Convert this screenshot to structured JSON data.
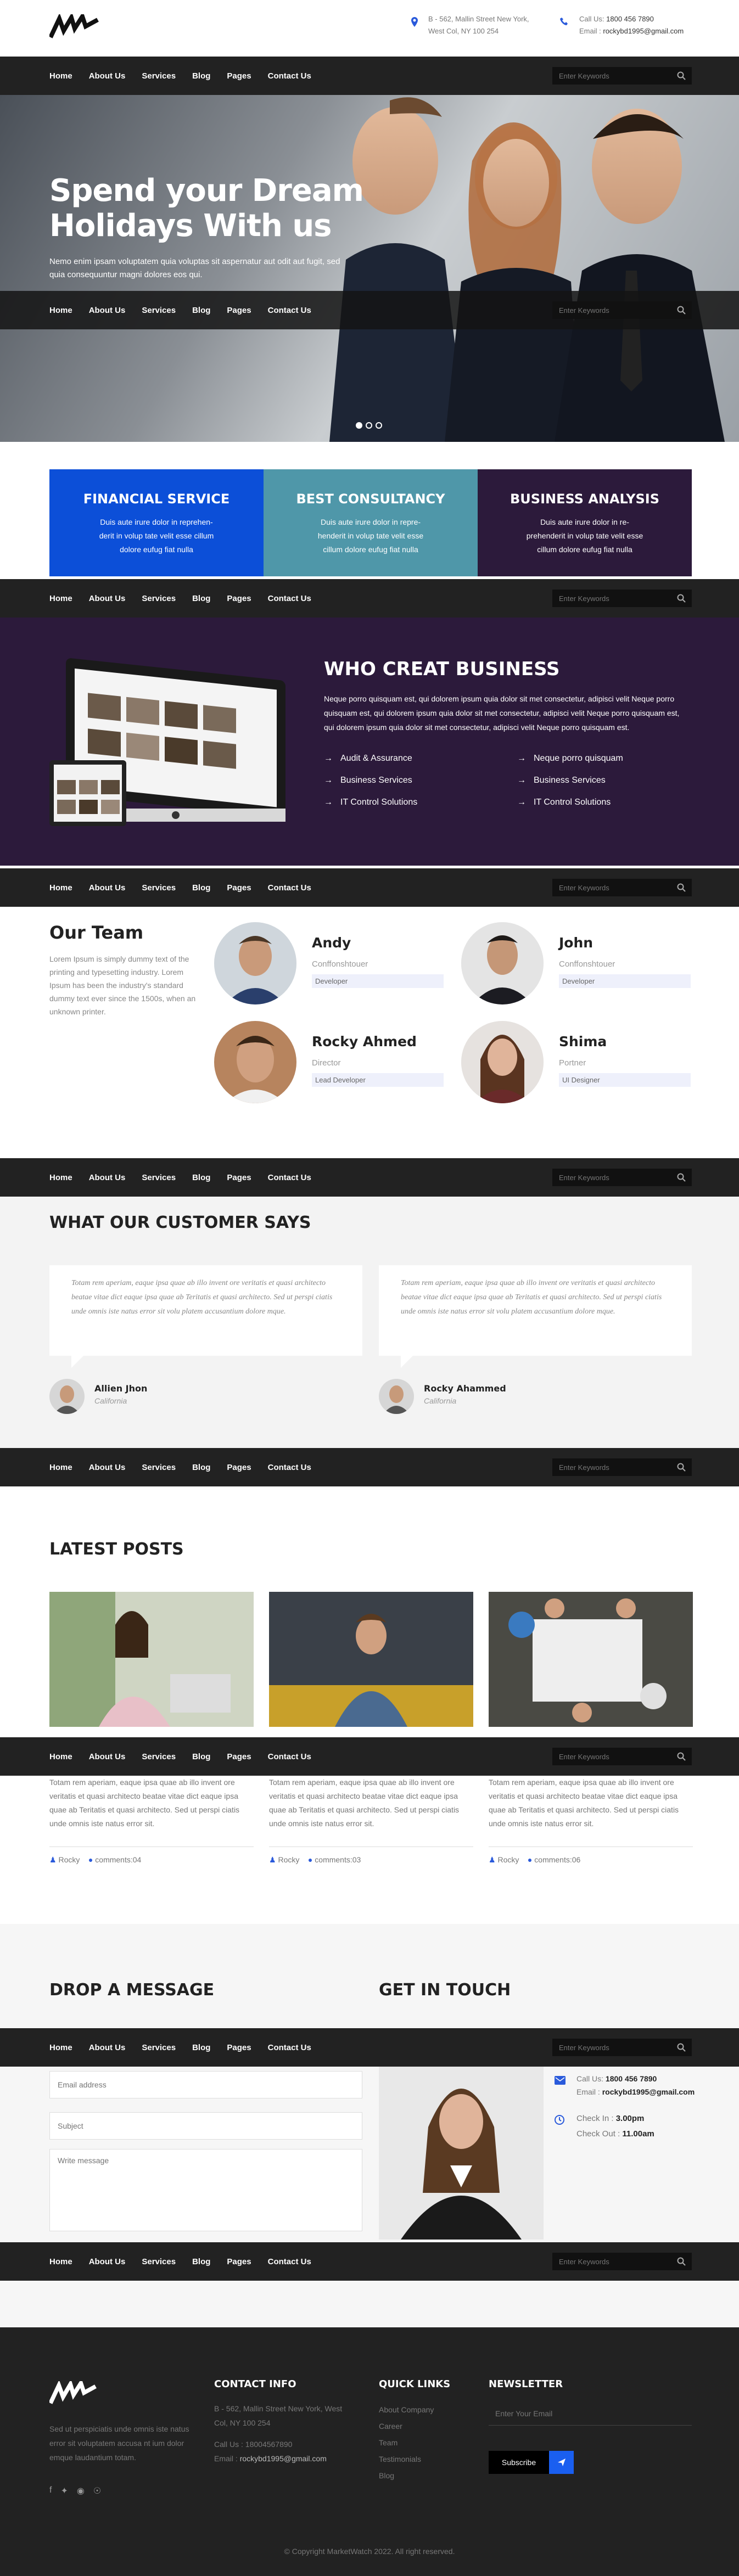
{
  "header": {
    "address_line1": "B - 562, Mallin Street New York,",
    "address_line2": "West Col, NY 100 254",
    "call_label": "Call Us:",
    "call_number": "1800 456 7890",
    "email_label": "Email :",
    "email": "rockybd1995@gmail.com",
    "accent": "#2a5adb"
  },
  "nav": {
    "items": [
      "Home",
      "About Us",
      "Services",
      "Blog",
      "Pages",
      "Contact Us"
    ],
    "search_placeholder": "Enter Keywords"
  },
  "hero": {
    "title_line1": "Spend your Dream",
    "title_line2": "Holidays With us",
    "text": "Nemo enim ipsam voluptatem quia voluptas sit aspernatur aut odit aut fugit, sed quia consequuntur magni dolores eos qui."
  },
  "services": [
    {
      "title": "FINANCIAL SERVICE",
      "text": "Duis aute irure dolor in reprehen-derit in volup tate velit esse cillum dolore eufug fiat nulla",
      "color": "#0c4fd8"
    },
    {
      "title": "BEST CONSULTANCY",
      "text": "Duis aute irure dolor in repre-henderit in volup tate velit esse cillum dolore eufug fiat nulla",
      "color": "#4f97a9"
    },
    {
      "title": "BUSINESS ANALYSIS",
      "text": "Duis aute irure dolor in re-prehenderit in volup tate velit esse cillum dolore eufug fiat nulla",
      "color": "#2c1a3b"
    }
  ],
  "who": {
    "title": "WHO CREAT BUSINESS",
    "text": "Neque porro quisquam est, qui dolorem ipsum quia dolor sit met consectetur, adipisci velit Neque porro quisquam est, qui dolorem ipsum quia dolor sit met consectetur, adipisci velit Neque porro quisquam est, qui dolorem ipsum quia dolor sit met consectetur, adipisci velit Neque porro quisquam est.",
    "list": [
      "Audit & Assurance",
      "Neque porro quisquam",
      "Business Services",
      "Business Services",
      "IT Control Solutions",
      "IT Control Solutions"
    ]
  },
  "team": {
    "title": "Our Team",
    "text": "Lorem Ipsum is simply dummy text of the printing and typesetting industry. Lorem Ipsum has been the industry's standard dummy text ever since the 1500s, when an unknown printer.",
    "members": [
      {
        "name": "Andy",
        "role": "Conffonshtouer",
        "tag": "Developer"
      },
      {
        "name": "John",
        "role": "Conffonshtouer",
        "tag": "Developer"
      },
      {
        "name": "Rocky Ahmed",
        "role": "Director",
        "tag": "Lead Developer"
      },
      {
        "name": "Shima",
        "role": "Portner",
        "tag": "UI Designer"
      }
    ]
  },
  "testimonials": {
    "title": "WHAT OUR CUSTOMER SAYS",
    "items": [
      {
        "text": "Totam rem aperiam, eaque ipsa quae ab illo invent ore veritatis et quasi architecto beatae vitae dict eaque ipsa quae ab Teritatis et quasi architecto. Sed ut perspi ciatis unde omnis iste natus error sit volu platem accusantium dolore mque.",
        "name": "Allien Jhon",
        "location": "California"
      },
      {
        "text": "Totam rem aperiam, eaque ipsa quae ab illo invent ore veritatis et quasi architecto beatae vitae dict eaque ipsa quae ab Teritatis et quasi architecto. Sed ut perspi ciatis unde omnis iste natus error sit volu platem accusantium dolore mque.",
        "name": "Rocky Ahammed",
        "location": "California"
      }
    ]
  },
  "posts": {
    "title": "LATEST POSTS",
    "items": [
      {
        "text": "Totam rem aperiam, eaque ipsa quae ab illo invent ore veritatis et quasi architecto beatae vitae dict eaque ipsa quae ab Teritatis et quasi architecto. Sed ut perspi ciatis unde omnis iste natus error sit.",
        "author": "Rocky",
        "comments": "comments:04"
      },
      {
        "text": "Totam rem aperiam, eaque ipsa quae ab illo invent ore veritatis et quasi architecto beatae vitae dict eaque ipsa quae ab Teritatis et quasi architecto. Sed ut perspi ciatis unde omnis iste natus error sit.",
        "author": "Rocky",
        "comments": "comments:03"
      },
      {
        "text": "Totam rem aperiam, eaque ipsa quae ab illo invent ore veritatis et quasi architecto beatae vitae dict eaque ipsa quae ab Teritatis et quasi architecto. Sed ut perspi ciatis unde omnis iste natus error sit.",
        "author": "Rocky",
        "comments": "comments:06"
      }
    ]
  },
  "contact": {
    "drop_title": "DROP A MESSAGE",
    "touch_title": "GET IN TOUCH",
    "email_placeholder": "Email address",
    "subject_placeholder": "Subject",
    "message_placeholder": "Write message",
    "call_label": "Call Us:",
    "call_number": "1800 456 7890",
    "email_label": "Email :",
    "email": "rockybd1995@gmail.com",
    "checkin_label": "Check In :",
    "checkin": "3.00pm",
    "checkout_label": "Check Out :",
    "checkout": "11.00am"
  },
  "footer": {
    "about": "Sed ut perspiciatis unde omnis iste natus error sit voluptatem accusa nt ium dolor emque laudantium totam.",
    "contact_title": "CONTACT INFO",
    "address": "B - 562, Mallin Street New York, West Col, NY 100 254",
    "call_label": "Call Us :",
    "call_number": "18004567890",
    "email_label": "Email :",
    "email": "rockybd1995@gmail.com",
    "links_title": "QUICK LINKS",
    "links": [
      "About Company",
      "Career",
      "Team",
      "Testimonials",
      "Blog"
    ],
    "newsletter_title": "NEWSLETTER",
    "newsletter_placeholder": "Enter Your Email",
    "subscribe_label": "Subscribe",
    "copyright": "© Copyright MarketWatch 2022. All right reserved."
  }
}
